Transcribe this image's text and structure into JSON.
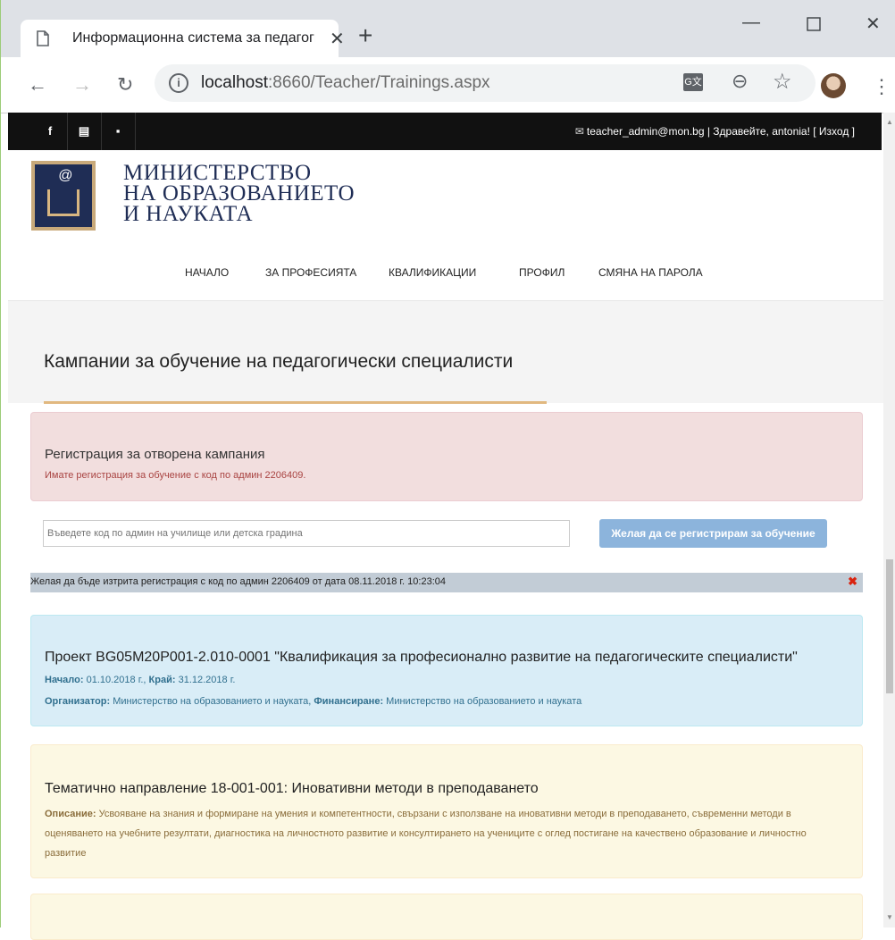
{
  "browser": {
    "tab_title": "Информационна система за педагогическите специалисти",
    "tab_close": "✕",
    "new_tab": "+",
    "url_host": "localhost",
    "url_path": ":8660/Teacher/Trainings.aspx"
  },
  "site": {
    "social": [
      "f",
      "▤",
      "▪"
    ],
    "user_email": "teacher_admin@mon.bg",
    "user_greeting": " | Здравейте, antonia! [ Изход ]",
    "ministry": [
      "МИНИСТЕРСТВО",
      "НА ОБРАЗОВАНИЕТО",
      "И НАУКАТА"
    ],
    "nav": [
      "НАЧАЛО",
      "ЗА ПРОФЕСИЯТА",
      "КВАЛИФИКАЦИИ",
      "ПРОФИЛ",
      "СМЯНА НА ПАРОЛА"
    ],
    "page_title": "Кампании за обучение на педагогически специалисти"
  },
  "registration": {
    "title": "Регистрация за отворена кампания",
    "subtitle": "Имате регистрация за обучение с код по админ 2206409.",
    "input_placeholder": "Въведете код по админ на училище или детска градина",
    "button": "Желая да се регистрирам за обучение",
    "delete_notice": "Желая да бъде изтрита регистрация с код по админ 2206409 от дата 08.11.2018 г. 10:23:04",
    "delete_icon": "✖"
  },
  "project": {
    "title": "Проект BG05M20P001-2.010-0001 \"Квалификация за професионално развитие на педагогическите специалисти\"",
    "start_label": "Начало:",
    "start": " 01.10.2018 г., ",
    "end_label": "Край:",
    "end": " 31.12.2018 г.",
    "org_label": "Организатор:",
    "org": " Министерство на образованието и науката, ",
    "fund_label": "Финансиране:",
    "fund": " Министерство на образованието и науката"
  },
  "topic": {
    "title": "Тематично направление 18-001-001: Иновативни методи в преподаването",
    "desc_label": "Описание:",
    "desc": " Усвояване на знания и формиране на умения и компетентности, свързани с използване на иновативни методи в преподаването, съвременни методи в оценяването на учебните резултати, диагностика на личностното развитие и консултирането на учениците с оглед постигане на качествено образование и личностно развитие"
  }
}
